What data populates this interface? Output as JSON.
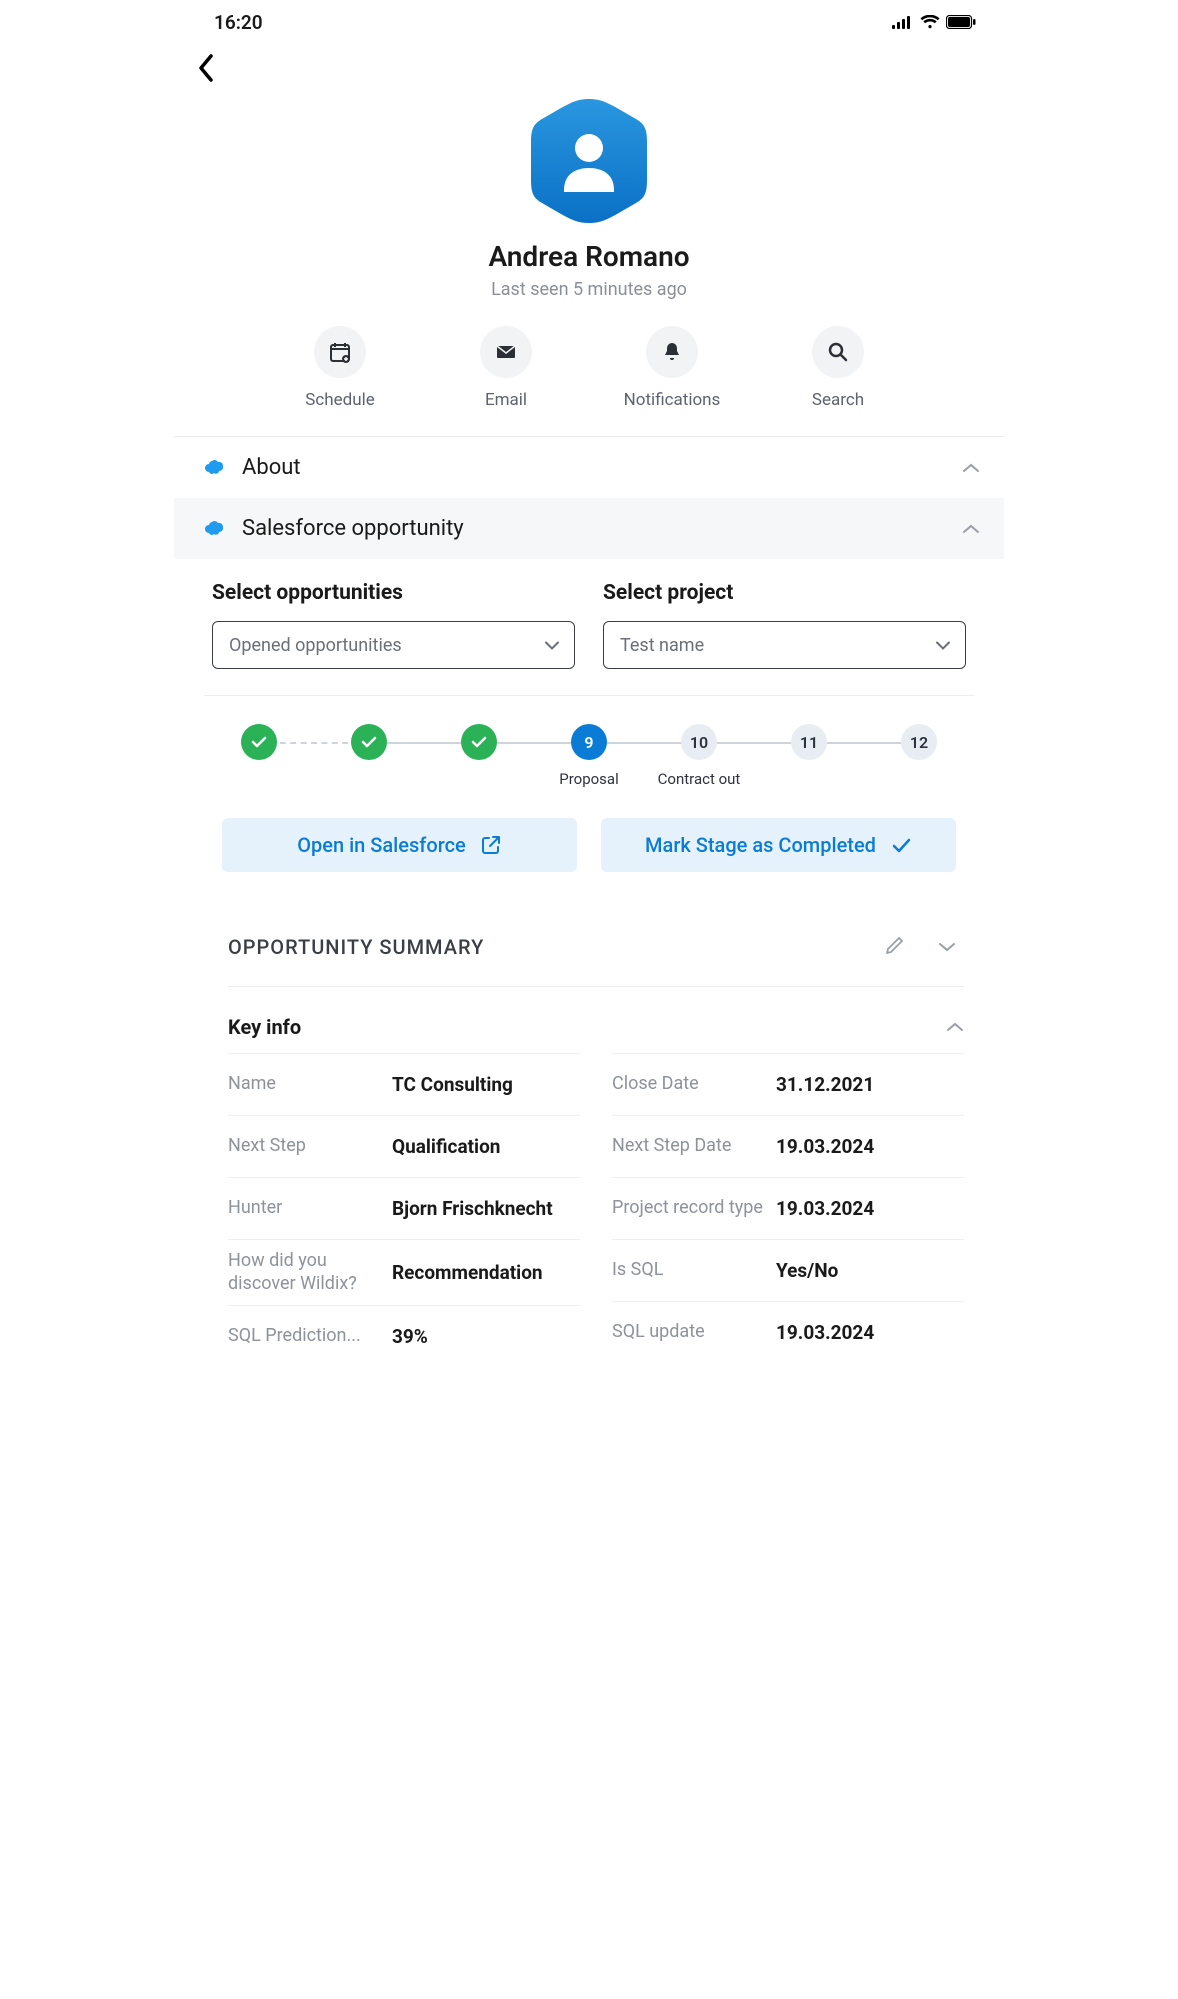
{
  "status": {
    "time": "16:20"
  },
  "profile": {
    "name": "Andrea Romano",
    "last_seen": "Last seen 5 minutes ago"
  },
  "actions": {
    "schedule": "Schedule",
    "email": "Email",
    "notifications": "Notifications",
    "search": "Search"
  },
  "accordion": {
    "about": "About",
    "opportunity": "Salesforce opportunity"
  },
  "selectors": {
    "opportunities_label": "Select opportunities",
    "opportunities_value": "Opened opportunities",
    "project_label": "Select project",
    "project_value": "Test name"
  },
  "stages": {
    "s9": "9",
    "s10": "10",
    "s11": "11",
    "s12": "12",
    "caption9": "Proposal",
    "caption10": "Contract out"
  },
  "buttons": {
    "open_sf": "Open in Salesforce",
    "mark_complete": "Mark Stage as Completed"
  },
  "summary": {
    "title": "OPPORTUNITY SUMMARY",
    "key_info": "Key info"
  },
  "kv": {
    "left": [
      {
        "label": "Name",
        "value": "TC Consulting"
      },
      {
        "label": "Next Step",
        "value": "Qualification"
      },
      {
        "label": "Hunter",
        "value": "Bjorn Frischknecht"
      },
      {
        "label": "How did you discover Wildix?",
        "value": "Recommendation"
      },
      {
        "label": "SQL Prediction...",
        "value": "39%"
      }
    ],
    "right": [
      {
        "label": "Close Date",
        "value": "31.12.2021"
      },
      {
        "label": "Next Step Date",
        "value": "19.03.2024"
      },
      {
        "label": "Project record type",
        "value": "19.03.2024"
      },
      {
        "label": "Is SQL",
        "value": "Yes/No"
      },
      {
        "label": "SQL update",
        "value": "19.03.2024"
      }
    ]
  }
}
